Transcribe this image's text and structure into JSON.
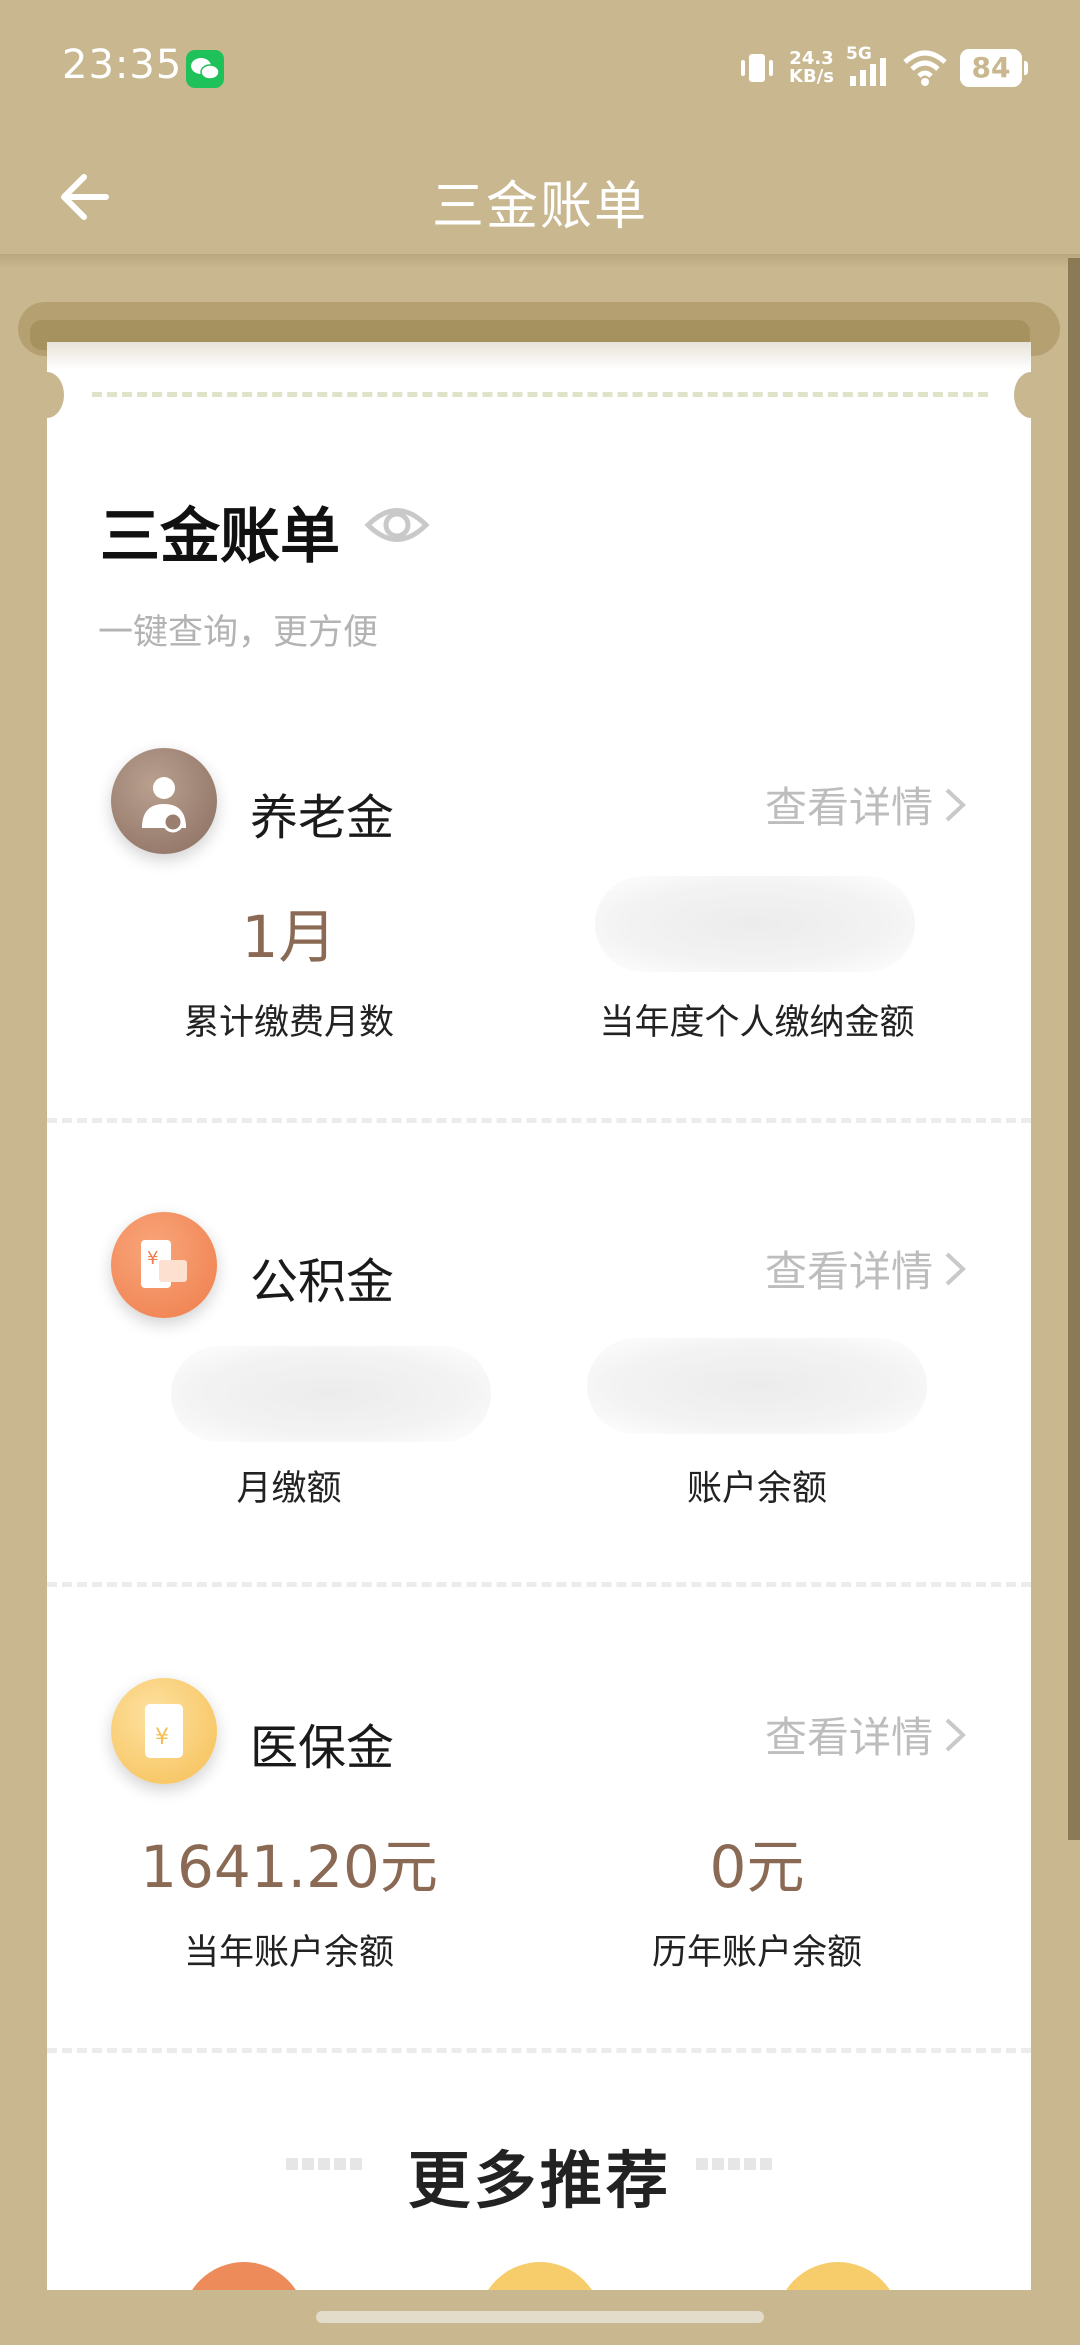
{
  "status_bar": {
    "time": "23:35",
    "network_speed_value": "24.3",
    "network_speed_unit": "KB/s",
    "network_type": "5G",
    "battery": "84"
  },
  "header": {
    "title": "三金账单"
  },
  "card": {
    "title": "三金账单",
    "subtitle": "一键查询，更方便"
  },
  "sections": [
    {
      "name": "养老金",
      "detail_link": "查看详情",
      "icon": "pension-icon",
      "left_value": "1月",
      "left_label": "累计缴费月数",
      "right_value": "",
      "right_label": "当年度个人缴纳金额"
    },
    {
      "name": "公积金",
      "detail_link": "查看详情",
      "icon": "housing-fund-icon",
      "left_value": "",
      "left_label": "月缴额",
      "right_value": "",
      "right_label": "账户余额"
    },
    {
      "name": "医保金",
      "detail_link": "查看详情",
      "icon": "medical-insurance-icon",
      "left_value": "1641.20元",
      "left_label": "当年账户余额",
      "right_value": "0元",
      "right_label": "历年账户余额"
    }
  ],
  "more": {
    "title": "更多推荐"
  },
  "colors": {
    "background": "#c8b78f",
    "value_brown": "#8a6a54",
    "pension_icon": "#9a7f70",
    "housing_icon": "#f08a5a",
    "medical_icon": "#f8c65c"
  }
}
